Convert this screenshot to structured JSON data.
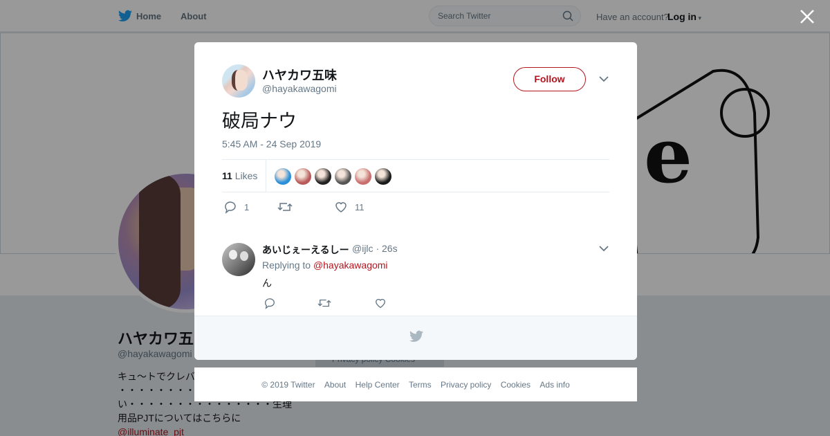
{
  "topbar": {
    "home_label": "Home",
    "about_label": "About",
    "search_placeholder": "Search Twitter",
    "account_question": "Have an account?",
    "login_label": "Log in"
  },
  "background_profile": {
    "name": "ハヤカワ五",
    "handle": "@hayakawagomi",
    "bio_lines": [
      "キュ〜トでクレバ",
      "・・・・・・・・",
      "い・・・・・・・・・・・・・・・生理",
      "用品PJTについてはこちらに"
    ],
    "bio_link": "@illuminate_pjt",
    "footer_pill": "Privacy policy  Cookies"
  },
  "tweet": {
    "author_name": "ハヤカワ五味",
    "author_handle": "@hayakawagomi",
    "follow_label": "Follow",
    "text": "破局ナウ",
    "timestamp": "5:45 AM - 24 Sep 2019",
    "likes_count": "11",
    "likes_label": "Likes",
    "reply_count": "1",
    "like_count": "11",
    "liker_colors": [
      "#2a8fd8",
      "#b85a5a",
      "#222222",
      "#555555",
      "#c96f6f",
      "#1a1a1a"
    ]
  },
  "reply": {
    "author_name": "あいじぇーえるしー",
    "author_handle": "@ijlc",
    "separator": "·",
    "time": "26s",
    "replying_prefix": "Replying to",
    "replying_to": "@hayakawagomi",
    "text": "ん"
  },
  "footer": {
    "links": [
      "© 2019 Twitter",
      "About",
      "Help Center",
      "Terms",
      "Privacy policy",
      "Cookies",
      "Ads info"
    ]
  },
  "colors": {
    "accent": "#b3141e",
    "brand_blue": "#1da1f2",
    "muted": "#657786"
  }
}
